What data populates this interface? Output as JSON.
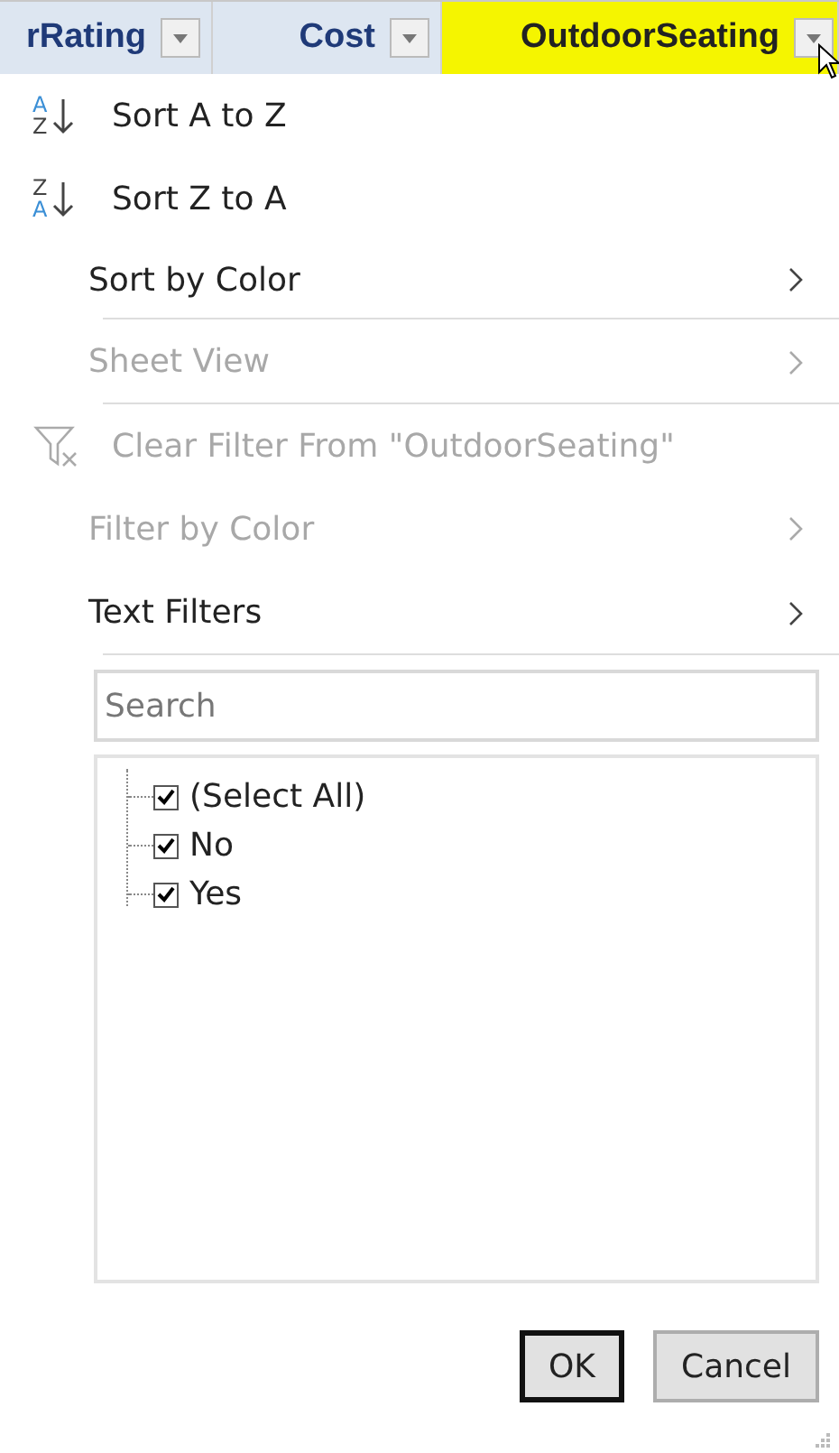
{
  "header_cells": [
    {
      "label": "rRating",
      "highlighted": false
    },
    {
      "label": "Cost",
      "highlighted": false
    },
    {
      "label": "OutdoorSeating",
      "highlighted": true
    }
  ],
  "menu_items": [
    {
      "kind": "sort_asc",
      "icon_letters": [
        "A",
        "Z"
      ],
      "label": "Sort A to Z",
      "disabled": false,
      "submenu": false,
      "separator_after": false
    },
    {
      "kind": "sort_desc",
      "icon_letters": [
        "Z",
        "A"
      ],
      "label": "Sort Z to A",
      "disabled": false,
      "submenu": false,
      "separator_after": false
    },
    {
      "kind": "plain",
      "label": "Sort by Color",
      "disabled": false,
      "submenu": true,
      "separator_after": true
    },
    {
      "kind": "plain",
      "label": "Sheet View",
      "disabled": true,
      "submenu": true,
      "separator_after": true
    },
    {
      "kind": "clear_filter",
      "label": "Clear Filter From \"OutdoorSeating\"",
      "disabled": true,
      "submenu": false,
      "separator_after": false
    },
    {
      "kind": "plain",
      "label": "Filter by Color",
      "disabled": true,
      "submenu": true,
      "separator_after": false
    },
    {
      "kind": "plain",
      "label": "Text Filters",
      "disabled": false,
      "submenu": true,
      "separator_after": true
    }
  ],
  "search": {
    "placeholder": "Search"
  },
  "values": [
    {
      "label": "(Select All)",
      "checked": true
    },
    {
      "label": "No",
      "checked": true
    },
    {
      "label": "Yes",
      "checked": true
    }
  ],
  "buttons": [
    {
      "label": "OK",
      "default": true
    },
    {
      "label": "Cancel",
      "default": false
    }
  ]
}
